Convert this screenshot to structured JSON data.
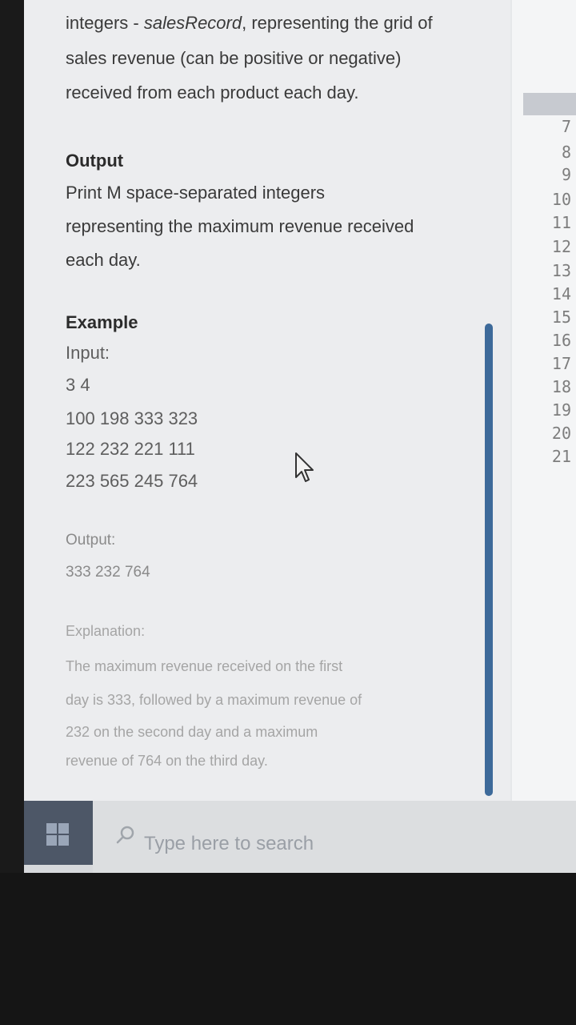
{
  "problem": {
    "intro_line1_prefix": "integers - ",
    "intro_line1_italic": "salesRecord",
    "intro_line1_suffix": ", representing the grid of",
    "intro_line2": "sales revenue (can be positive or negative)",
    "intro_line3": "received from each product each day.",
    "output_heading": "Output",
    "output_line1": "Print M space-separated integers",
    "output_line2": "representing the maximum revenue received",
    "output_line3": "each day.",
    "example_heading": "Example",
    "input_label": "Input:",
    "input_lines": [
      "3 4",
      "100 198 333 323",
      "122 232 221 111",
      "223 565 245 764"
    ],
    "output_label": "Output:",
    "output_value": "333 232 764",
    "explanation_label": "Explanation:",
    "explanation_lines": [
      "The maximum revenue received on the first",
      "day is 333, followed by a maximum revenue of",
      "232 on the second day and a maximum",
      "revenue of 764 on the third day."
    ]
  },
  "editor": {
    "line_numbers": [
      "7",
      "8",
      "9",
      "10",
      "11",
      "12",
      "13",
      "14",
      "15",
      "16",
      "17",
      "18",
      "19",
      "20",
      "21"
    ]
  },
  "taskbar": {
    "search_placeholder": "Type here to search"
  },
  "colors": {
    "scrollbar": "#3d6a9a",
    "taskbar_start": "#4d5767"
  }
}
